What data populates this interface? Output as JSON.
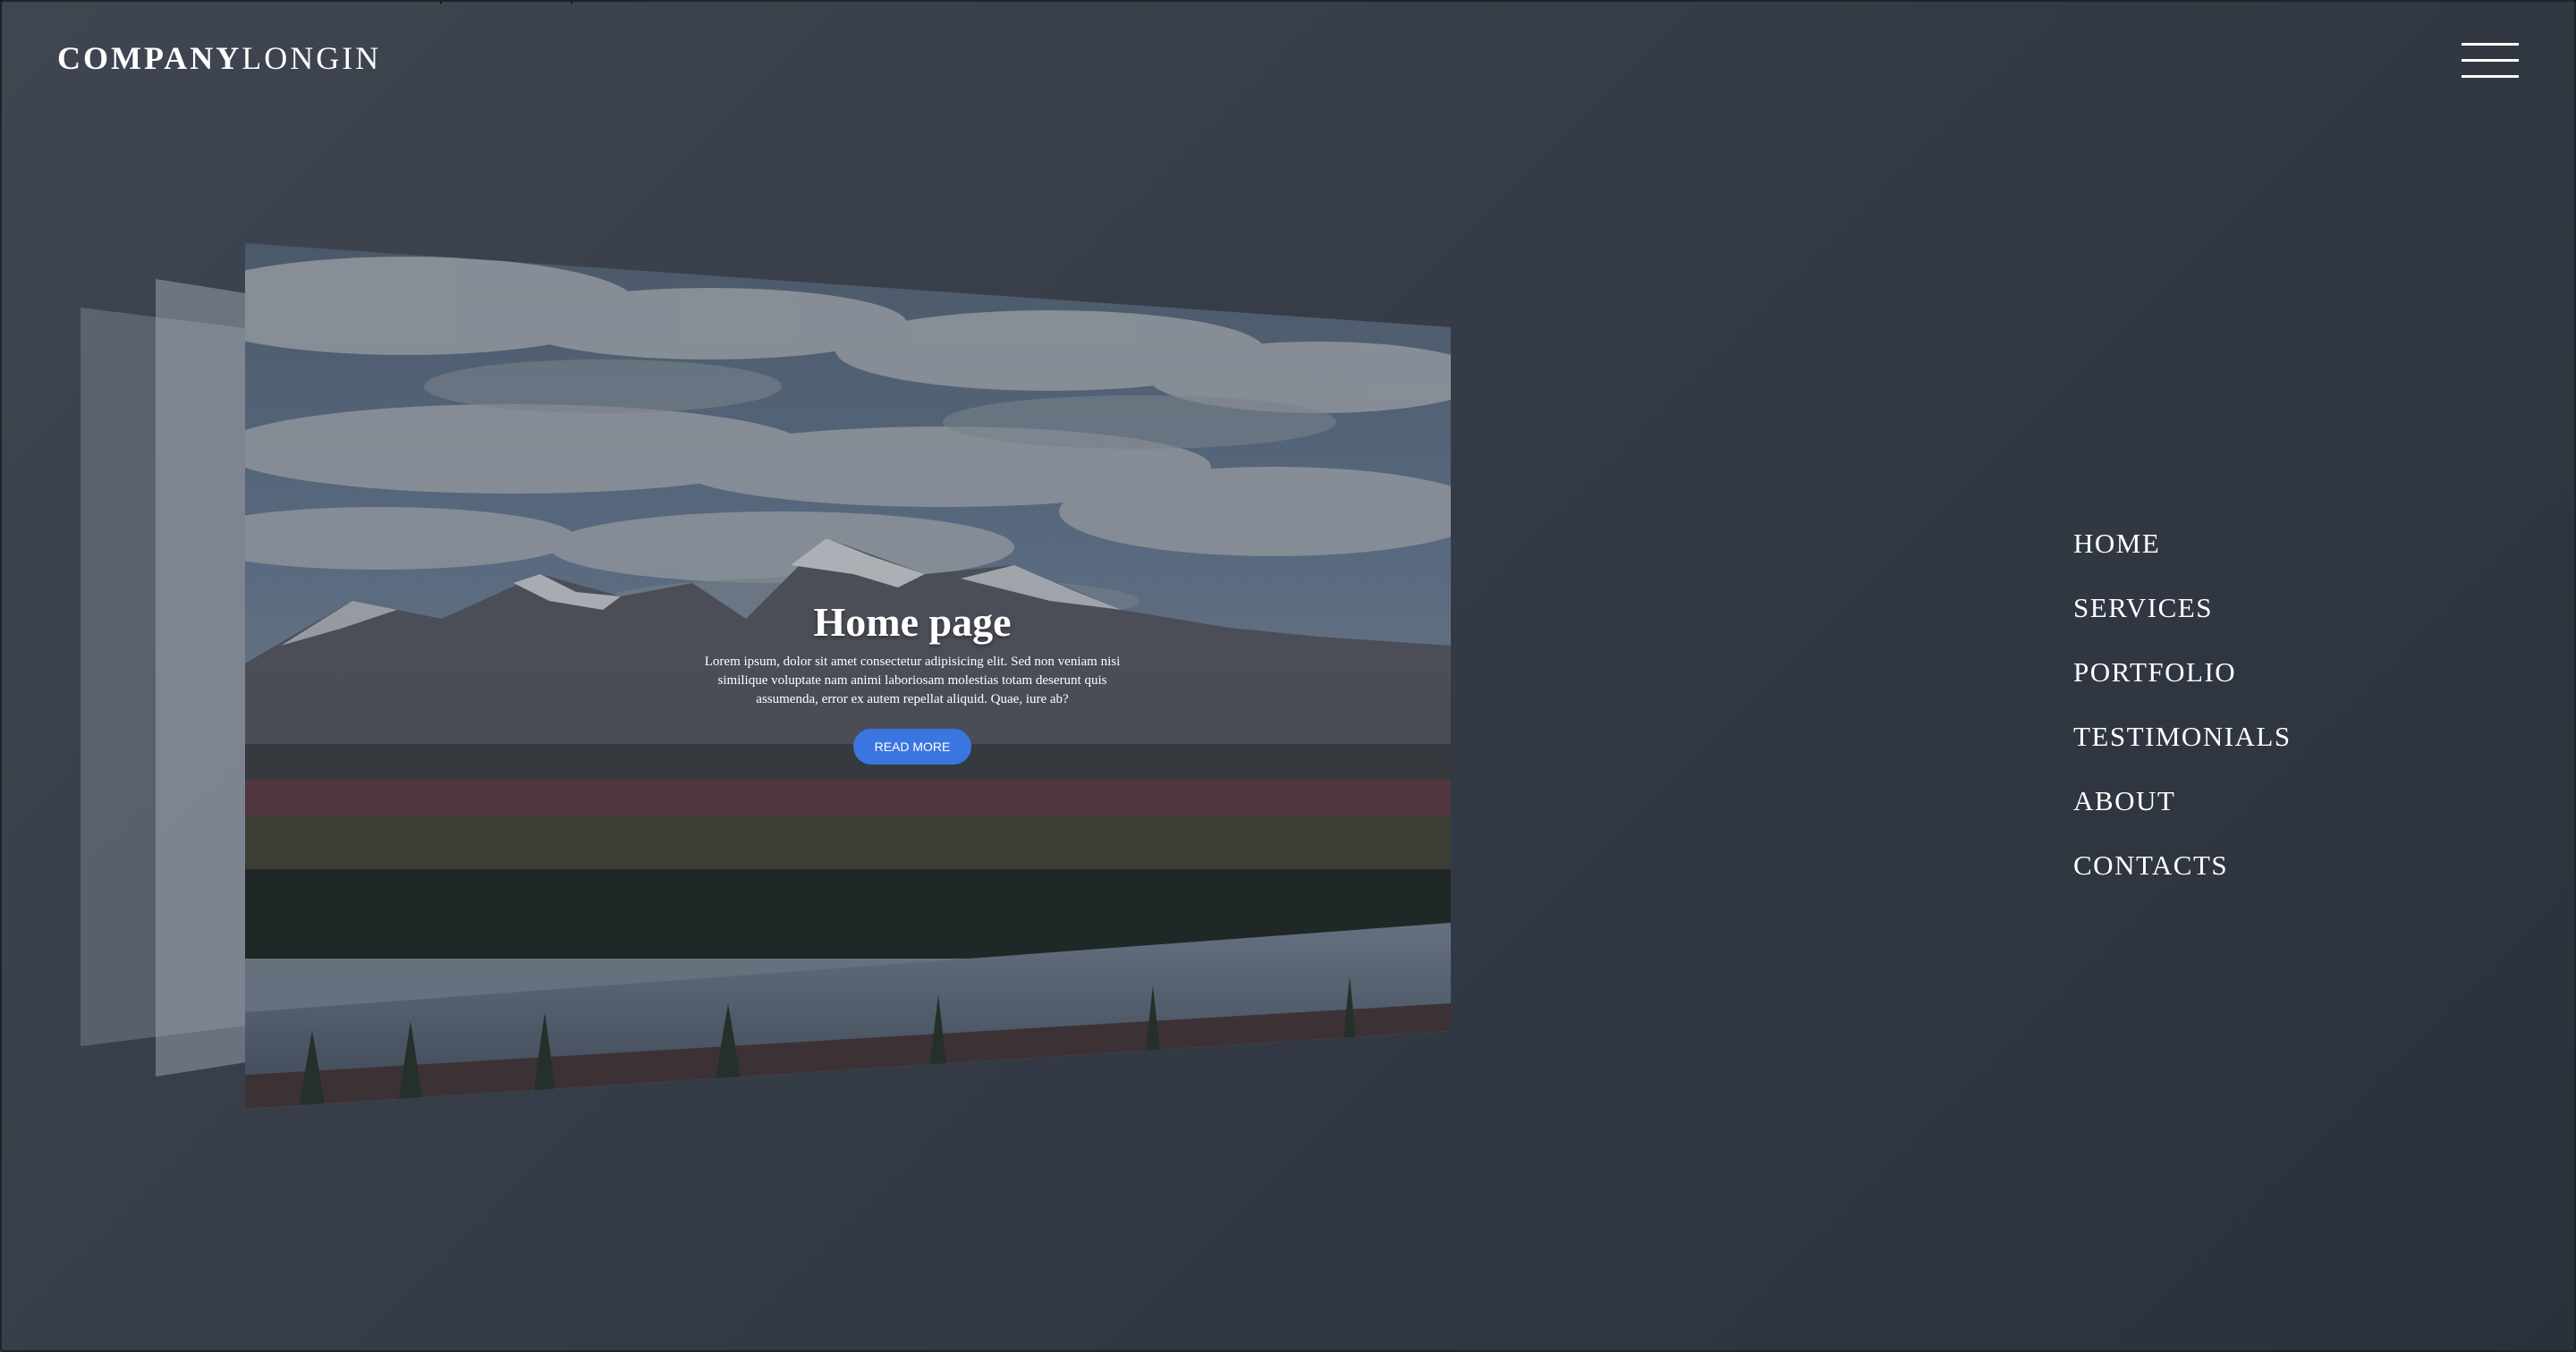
{
  "header": {
    "logo_bold": "COMPANY",
    "logo_light": "LONGIN",
    "menu_icon": "hamburger-icon"
  },
  "hero": {
    "title": "Home page",
    "body": "Lorem ipsum, dolor sit amet consectetur adipisicing elit. Sed non veniam nisi similique voluptate nam animi laboriosam molestias totam deserunt quis assumenda, error ex autem repellat aliquid. Quae, iure ab?",
    "cta_label": "READ MORE",
    "cta_color": "#3b76e0"
  },
  "nav": {
    "items": [
      {
        "label": "HOME"
      },
      {
        "label": "SERVICES"
      },
      {
        "label": "PORTFOLIO"
      },
      {
        "label": "TESTIMONIALS"
      },
      {
        "label": "ABOUT"
      },
      {
        "label": "CONTACTS"
      }
    ]
  },
  "colors": {
    "background": "#353c47",
    "text": "#ffffff"
  }
}
